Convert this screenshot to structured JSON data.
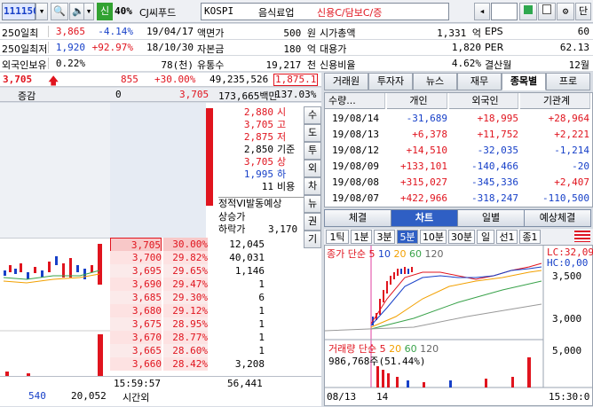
{
  "toolbar": {
    "code": "111150",
    "level": "신",
    "pct": "40%",
    "name": "CJ씨푸드",
    "market": "KOSPI",
    "sector": "음식료업",
    "credit": "신용C/담보C/증",
    "right_btn": "단"
  },
  "info": [
    {
      "l": "250일최",
      "v": "3,865",
      "v_color": "red",
      "c": "-4.14%",
      "c_color": "blue",
      "d": "19/04/17",
      "k": "액면가",
      "kv": "500 원",
      "k2": "시가총액",
      "k2v": "1,331 억",
      "k3": "EPS",
      "k3v": "60"
    },
    {
      "l": "250일최저",
      "v": "1,920",
      "v_color": "blue",
      "c": "+92.97%",
      "c_color": "red",
      "d": "18/10/30",
      "k": "자본금",
      "kv": "180 억",
      "k2": "대용가",
      "k2v": "1,820",
      "k3": "PER",
      "k3v": "62.13"
    },
    {
      "l": "외국인보유",
      "v": "0.22%",
      "v_color": "black",
      "c": "",
      "c_color": "black",
      "d": "78(천)",
      "k": "유통수",
      "kv": "19,217 천",
      "k2": "신용비율",
      "k2v": "4.62%",
      "k3": "결산월",
      "k3v": "12월"
    }
  ],
  "price_bar": {
    "price": "3,705",
    "diff": "855",
    "rate": "+30.00%",
    "volume": "49,235,526",
    "prev": "1,875.1"
  },
  "obook_head": {
    "label": "증감",
    "zero": "0",
    "price": "3,705",
    "amount": "173,665백만",
    "ratio": "137.03%"
  },
  "ask_info": [
    {
      "v": "2,880",
      "k": "시",
      "color": "red"
    },
    {
      "v": "3,705",
      "k": "고",
      "color": "red"
    },
    {
      "v": "2,875",
      "k": "저",
      "color": "red"
    },
    {
      "v": "2,850",
      "k": "기준",
      "color": "black"
    },
    {
      "v": "3,705",
      "k": "상",
      "color": "red"
    },
    {
      "v": "1,995",
      "k": "하",
      "color": "blue"
    },
    {
      "v": "11",
      "k": "비용",
      "color": "black"
    }
  ],
  "vi": {
    "title": "정적VI발동예상",
    "up_label": "상승가",
    "down_label": "하락가",
    "down_val": "3,170"
  },
  "side_btns": [
    "수",
    "도",
    "투",
    "외",
    "차",
    "뉴",
    "권",
    "기"
  ],
  "bids": [
    {
      "p": "3,705",
      "r": "30.00%",
      "q": "12,045"
    },
    {
      "p": "3,700",
      "r": "29.82%",
      "q": "40,031"
    },
    {
      "p": "3,695",
      "r": "29.65%",
      "q": "1,146"
    },
    {
      "p": "3,690",
      "r": "29.47%",
      "q": "1"
    },
    {
      "p": "3,685",
      "r": "29.30%",
      "q": "6"
    },
    {
      "p": "3,680",
      "r": "29.12%",
      "q": "1"
    },
    {
      "p": "3,675",
      "r": "28.95%",
      "q": "1"
    },
    {
      "p": "3,670",
      "r": "28.77%",
      "q": "1"
    },
    {
      "p": "3,665",
      "r": "28.60%",
      "q": "1"
    },
    {
      "p": "3,660",
      "r": "28.42%",
      "q": "3,208"
    }
  ],
  "obook_foot": {
    "time": "15:59:57",
    "time_label": "시간외",
    "total": "56,441",
    "left1": "540",
    "left2": "20,052"
  },
  "tabs": [
    "거래원",
    "투자자",
    "뉴스",
    "재무",
    "종목별",
    "프로"
  ],
  "investor": {
    "head": [
      "수량...",
      "개인",
      "외국인",
      "기관계"
    ],
    "rows": [
      {
        "d": "19/08/14",
        "a": "-31,689",
        "b": "+18,995",
        "c": "+28,964"
      },
      {
        "d": "19/08/13",
        "a": "+6,378",
        "b": "+11,752",
        "c": "+2,221"
      },
      {
        "d": "19/08/12",
        "a": "+14,510",
        "b": "-32,035",
        "c": "-1,214"
      },
      {
        "d": "19/08/09",
        "a": "+133,101",
        "b": "-140,466",
        "c": "-20"
      },
      {
        "d": "19/08/08",
        "a": "+315,027",
        "b": "-345,336",
        "c": "+2,407"
      },
      {
        "d": "19/08/07",
        "a": "+422,966",
        "b": "-318,247",
        "c": "-110,500"
      }
    ]
  },
  "chart_tabs": [
    "체결",
    "차트",
    "일별",
    "예상체결"
  ],
  "periods": [
    "1틱",
    "1분",
    "3분",
    "5분",
    "10분",
    "30분",
    "일",
    "선1",
    "종1"
  ],
  "chart": {
    "legend_title": "종가 단순",
    "ma": [
      "5",
      "10",
      "20",
      "60",
      "120"
    ],
    "lc": "LC:32,09",
    "hc": "HC:0,00",
    "yticks": [
      "3,500",
      "3,000",
      "5,000"
    ],
    "vol_title": "거래량 단순",
    "vol_ma": [
      "5",
      "20",
      "60",
      "120"
    ],
    "vol_value": "986,768주(51.44%)",
    "x1": "08/13",
    "x2": "14",
    "time": "15:30:0"
  }
}
